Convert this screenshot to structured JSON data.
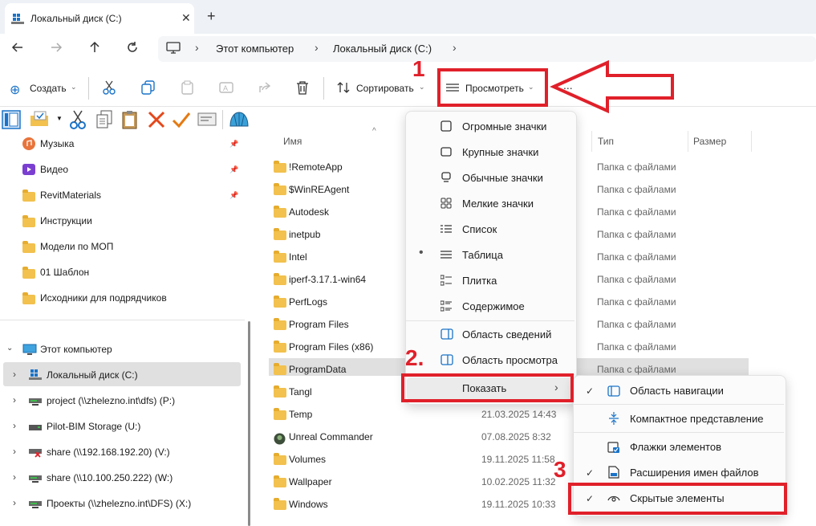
{
  "window": {
    "tab_title": "Локальный диск (C:)",
    "tab_close": "✕",
    "new_tab": "+"
  },
  "address": {
    "crumbs": [
      "Этот компьютер",
      "Локальный диск (C:)"
    ]
  },
  "commands": {
    "create": "Создать",
    "sort": "Сортировать",
    "view": "Просмотреть",
    "more": "..."
  },
  "nav": {
    "quick": [
      {
        "label": "Музыка",
        "icon": "music-icon",
        "pinned": true
      },
      {
        "label": "Видео",
        "icon": "video-icon",
        "pinned": true
      },
      {
        "label": "RevitMaterials",
        "icon": "folder-icon",
        "pinned": true
      },
      {
        "label": "Инструкции",
        "icon": "folder-icon",
        "pinned": false
      },
      {
        "label": "Модели по МОП",
        "icon": "folder-icon",
        "pinned": false
      },
      {
        "label": "01 Шаблон",
        "icon": "folder-icon",
        "pinned": false
      },
      {
        "label": "Исходники для подрядчиков",
        "icon": "folder-icon",
        "pinned": false
      }
    ],
    "this_pc": "Этот компьютер",
    "drives": [
      {
        "label": "Локальный диск (C:)",
        "selected": true
      },
      {
        "label": "project (\\\\zhelezno.int\\dfs) (P:)"
      },
      {
        "label": "Pilot-BIM Storage (U:)"
      },
      {
        "label": "share (\\\\192.168.192.20) (V:)"
      },
      {
        "label": "share (\\\\10.100.250.222) (W:)"
      },
      {
        "label": "Проекты (\\\\zhelezno.int\\DFS) (X:)"
      }
    ]
  },
  "columns": {
    "name": "Имя",
    "type": "Тип",
    "size": "Размер"
  },
  "files": [
    {
      "name": "!RemoteApp",
      "date": "",
      "type": "Папка с файлами"
    },
    {
      "name": "$WinREAgent",
      "date": "",
      "type": "Папка с файлами"
    },
    {
      "name": "Autodesk",
      "date": "",
      "type": "Папка с файлами"
    },
    {
      "name": "inetpub",
      "date": "",
      "type": "Папка с файлами"
    },
    {
      "name": "Intel",
      "date": "",
      "type": "Папка с файлами"
    },
    {
      "name": "iperf-3.17.1-win64",
      "date": "",
      "type": "Папка с файлами"
    },
    {
      "name": "PerfLogs",
      "date": "",
      "type": "Папка с файлами"
    },
    {
      "name": "Program Files",
      "date": "",
      "type": "Папка с файлами"
    },
    {
      "name": "Program Files (x86)",
      "date": "",
      "type": "Папка с файлами"
    },
    {
      "name": "ProgramData",
      "date": "",
      "type": "Папка с файлами"
    },
    {
      "name": "Tangl",
      "date": "",
      "type": ""
    },
    {
      "name": "Temp",
      "date": "21.03.2025 14:43",
      "type": ""
    },
    {
      "name": "Unreal Commander",
      "date": "07.08.2025 8:32",
      "type": ""
    },
    {
      "name": "Volumes",
      "date": "19.11.2025 11:58",
      "type": ""
    },
    {
      "name": "Wallpaper",
      "date": "10.02.2025 11:32",
      "type": ""
    },
    {
      "name": "Windows",
      "date": "19.11.2025 10:33",
      "type": ""
    }
  ],
  "view_menu": {
    "items": [
      {
        "label": "Огромные значки",
        "icon": "extra-large-icons-icon"
      },
      {
        "label": "Крупные значки",
        "icon": "large-icons-icon"
      },
      {
        "label": "Обычные значки",
        "icon": "medium-icons-icon"
      },
      {
        "label": "Мелкие значки",
        "icon": "small-icons-icon"
      },
      {
        "label": "Список",
        "icon": "list-icon"
      },
      {
        "label": "Таблица",
        "icon": "details-icon",
        "selected": true
      },
      {
        "label": "Плитка",
        "icon": "tiles-icon"
      },
      {
        "label": "Содержимое",
        "icon": "content-icon"
      }
    ],
    "panes": [
      {
        "label": "Область сведений",
        "icon": "details-pane-icon"
      },
      {
        "label": "Область просмотра",
        "icon": "preview-pane-icon"
      }
    ],
    "show": "Показать"
  },
  "show_menu": {
    "items": [
      {
        "label": "Область навигации",
        "checked": true,
        "icon": "navigation-pane-icon"
      },
      {
        "label": "Компактное представление",
        "checked": false,
        "icon": "compact-view-icon"
      },
      {
        "label": "Флажки элементов",
        "checked": false,
        "icon": "item-checkboxes-icon"
      },
      {
        "label": "Расширения имен файлов",
        "checked": true,
        "icon": "file-extensions-icon"
      },
      {
        "label": "Скрытые элементы",
        "checked": true,
        "icon": "hidden-items-icon"
      }
    ]
  },
  "annotations": {
    "one": "1",
    "two": "2.",
    "three": "3"
  },
  "colors": {
    "accent_red": "#e0202a",
    "folder": "#f2c14e"
  }
}
